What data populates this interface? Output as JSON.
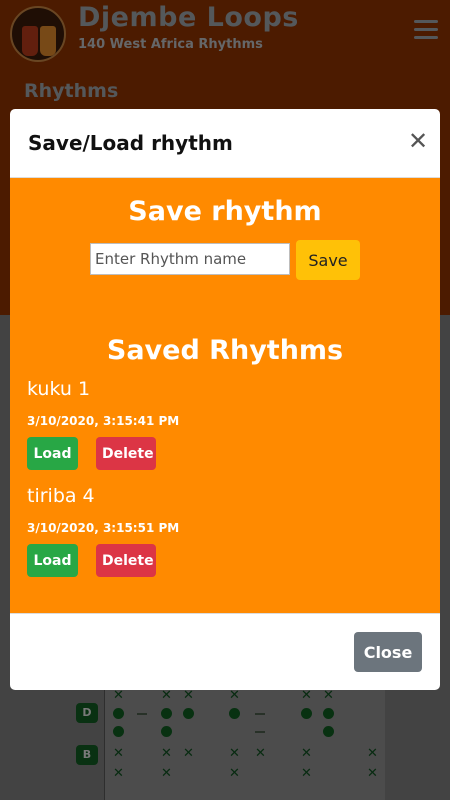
{
  "app": {
    "title": "Djembe Loops",
    "subtitle": "140 West Africa Rhythms",
    "menu_icon": "hamburger-menu-icon",
    "logo_icon": "djembe-drums-logo"
  },
  "page": {
    "section_label": "Rhythms"
  },
  "background_grid": {
    "instrument_icons": [
      "djembe-icon",
      "bell-icon"
    ]
  },
  "modal": {
    "title": "Save/Load rhythm",
    "close_icon": "close-icon",
    "save_heading": "Save rhythm",
    "input_placeholder": "Enter Rhythm name",
    "input_value": "",
    "save_label": "Save",
    "saved_heading": "Saved Rhythms",
    "saved_rhythms": [
      {
        "name": "kuku 1",
        "date": "3/10/2020, 3:15:41 PM",
        "load_label": "Load",
        "delete_label": "Delete"
      },
      {
        "name": "tiriba 4",
        "date": "3/10/2020, 3:15:51 PM",
        "load_label": "Load",
        "delete_label": "Delete"
      }
    ],
    "close_label": "Close"
  },
  "colors": {
    "header_bg": "#8a3200",
    "modal_body": "#ff8a00",
    "save_button": "#ffc107",
    "load_button": "#28a745",
    "delete_button": "#dc3545",
    "close_button": "#6c757d"
  }
}
